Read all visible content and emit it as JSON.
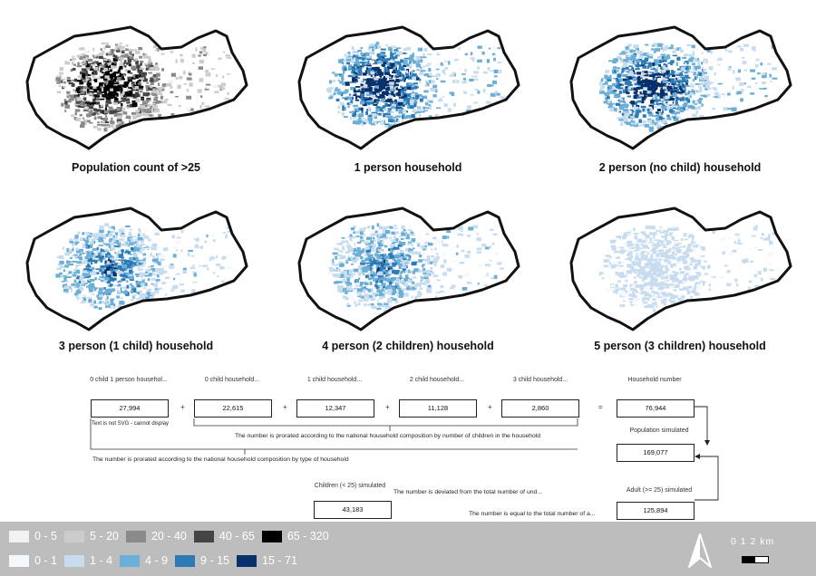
{
  "maps": [
    {
      "title": "Population count of >25",
      "palette": "grey",
      "intensity": 1.0
    },
    {
      "title": "1 person household",
      "palette": "blue",
      "intensity": 1.0
    },
    {
      "title": "2 person (no child) household",
      "palette": "blue",
      "intensity": 0.95
    },
    {
      "title": "3 person (1 child) household",
      "palette": "blue",
      "intensity": 0.6
    },
    {
      "title": "4 person (2 children) household",
      "palette": "blue",
      "intensity": 0.55
    },
    {
      "title": "5 person (3 children) household",
      "palette": "blue",
      "intensity": 0.2
    }
  ],
  "flow": {
    "headers": [
      "0 child 1 person househol...",
      "0 child household...",
      "1 child household...",
      "2 child household...",
      "3 child household...",
      "Household number"
    ],
    "values": [
      "27,994",
      "22,615",
      "12,347",
      "11,128",
      "2,860",
      "76,944"
    ],
    "plus": "+",
    "equals": "=",
    "svg_warning": "Text is not SVG - cannot display",
    "note_children": "The number is prorated according to the national household composition by number of children in the household",
    "note_type": "The number is prorated according to the national household composition by type of household",
    "population_label": "Population simulated",
    "population_value": "169,077",
    "children_label": "Children (< 25) simulated",
    "children_value": "43,183",
    "deviation_note": "The number is deviated from the total number of und...",
    "adult_label": "Adult (>= 25) simulated",
    "adult_value": "125,894",
    "equal_note": "The number is equal to the total number of a..."
  },
  "legend": {
    "grey": [
      {
        "label": "0 - 5",
        "color": "#f2f2f2"
      },
      {
        "label": "5 - 20",
        "color": "#cccccc"
      },
      {
        "label": "20 - 40",
        "color": "#8a8a8a"
      },
      {
        "label": "40 - 65",
        "color": "#444444"
      },
      {
        "label": "65 - 320",
        "color": "#000000"
      }
    ],
    "blue": [
      {
        "label": "0 - 1",
        "color": "#f4f8fc"
      },
      {
        "label": "1 - 4",
        "color": "#c7dcef"
      },
      {
        "label": "4 - 9",
        "color": "#6baed6"
      },
      {
        "label": "9 - 15",
        "color": "#2c7bb6"
      },
      {
        "label": "15 - 71",
        "color": "#08306b"
      }
    ]
  },
  "scale": {
    "label": "0  1  2 km"
  }
}
